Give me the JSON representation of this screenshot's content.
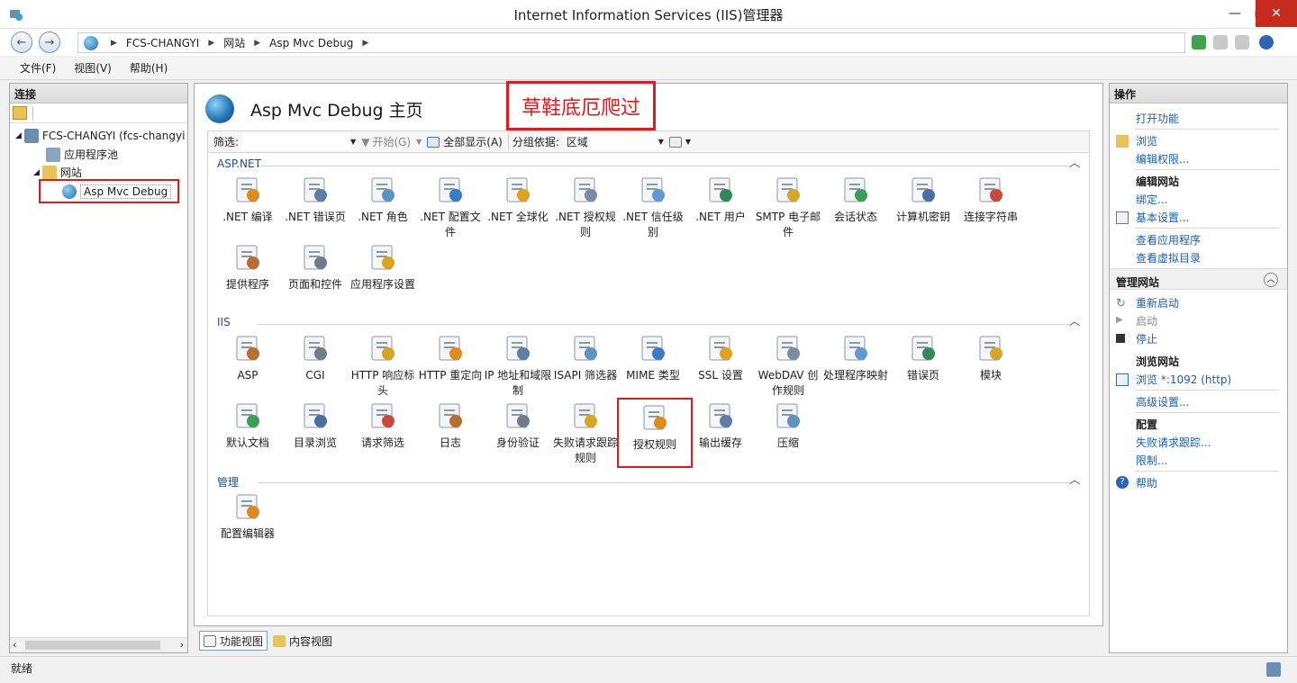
{
  "window": {
    "title": "Internet Information Services (IIS)管理器"
  },
  "address": {
    "crumbs": [
      "FCS-CHANGYI",
      "网站",
      "Asp Mvc Debug"
    ]
  },
  "menu": [
    "文件(F)",
    "视图(V)",
    "帮助(H)"
  ],
  "left": {
    "title": "连接",
    "tree": {
      "server": "FCS-CHANGYI (fcs-changyi",
      "pools": "应用程序池",
      "sites": "网站",
      "site": "Asp Mvc Debug"
    }
  },
  "center": {
    "title": "Asp Mvc Debug 主页",
    "annotation": "草鞋底厄爬过",
    "filter_label": "筛选:",
    "start_label": "开始(G)",
    "show_all_label": "全部显示(A)",
    "group_label": "分组依据:",
    "group_value": "区域",
    "sections": {
      "aspnet": "ASP.NET",
      "iis": "IIS",
      "manage": "管理"
    },
    "aspnet_tiles": [
      ".NET 编译",
      ".NET 错误页",
      ".NET 角色",
      ".NET 配置文件",
      ".NET 全球化",
      ".NET 授权规则",
      ".NET 信任级别",
      ".NET 用户",
      "SMTP 电子邮件",
      "会话状态",
      "计算机密钥",
      "连接字符串",
      "提供程序",
      "页面和控件",
      "应用程序设置"
    ],
    "iis_tiles": [
      "ASP",
      "CGI",
      "HTTP 响应标头",
      "HTTP 重定向",
      "IP 地址和域限制",
      "ISAPI 筛选器",
      "MIME 类型",
      "SSL 设置",
      "WebDAV 创作规则",
      "处理程序映射",
      "错误页",
      "模块",
      "默认文档",
      "目录浏览",
      "请求筛选",
      "日志",
      "身份验证",
      "失败请求跟踪规则",
      "授权规则",
      "输出缓存",
      "压缩"
    ],
    "manage_tiles": [
      "配置编辑器"
    ]
  },
  "view_tabs": {
    "features": "功能视图",
    "content": "内容视图"
  },
  "right": {
    "title": "操作",
    "open_feature": "打开功能",
    "browse": "浏览",
    "edit_perms": "编辑权限...",
    "edit_site": "编辑网站",
    "bindings": "绑定...",
    "basic_settings": "基本设置...",
    "view_apps": "查看应用程序",
    "view_vdirs": "查看虚拟目录",
    "manage_site": "管理网站",
    "restart": "重新启动",
    "start": "启动",
    "stop": "停止",
    "browse_site": "浏览网站",
    "browse_port": "浏览 *:1092 (http)",
    "advanced": "高级设置...",
    "config": "配置",
    "failed_trace": "失败请求跟踪...",
    "limits": "限制...",
    "help": "帮助"
  },
  "status": {
    "text": "就绪"
  }
}
